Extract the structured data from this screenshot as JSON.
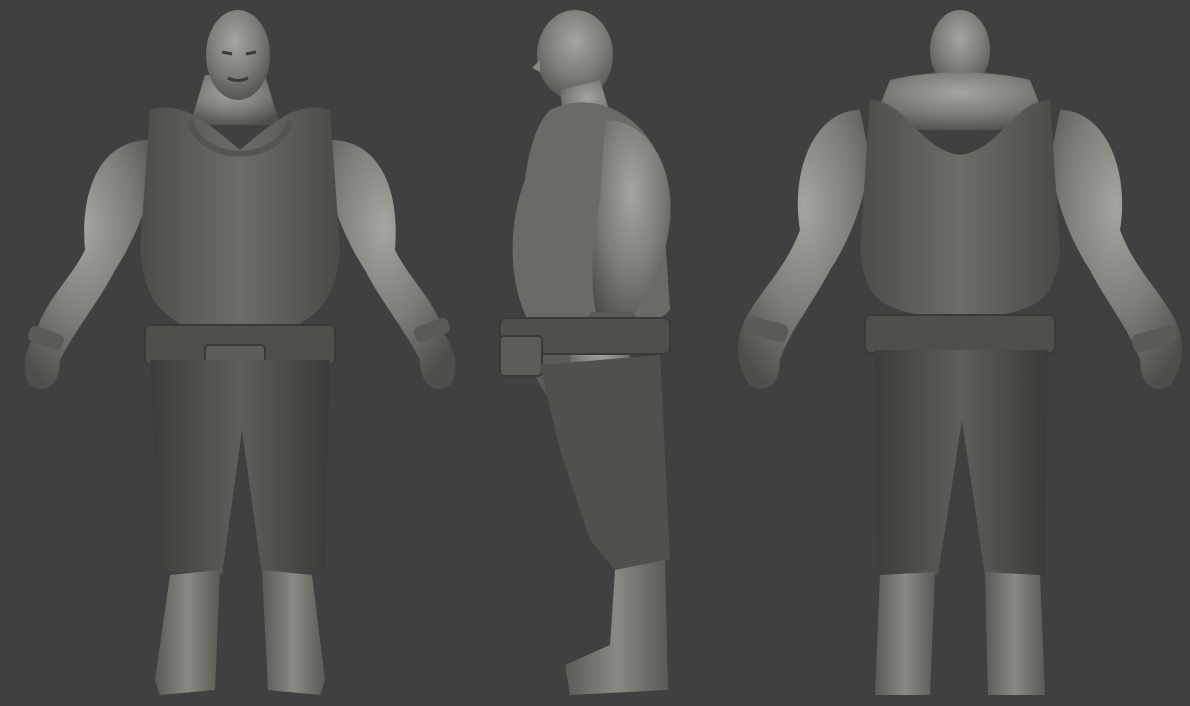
{
  "scene": {
    "background_color": "#404040",
    "clay_color": "#7a7a76",
    "clay_highlight": "#a2a29c",
    "clay_shadow": "#4e4e4b",
    "views": [
      {
        "id": "front",
        "description_name": "character-front-view"
      },
      {
        "id": "side",
        "description_name": "character-side-view"
      },
      {
        "id": "back",
        "description_name": "character-back-view"
      }
    ]
  }
}
